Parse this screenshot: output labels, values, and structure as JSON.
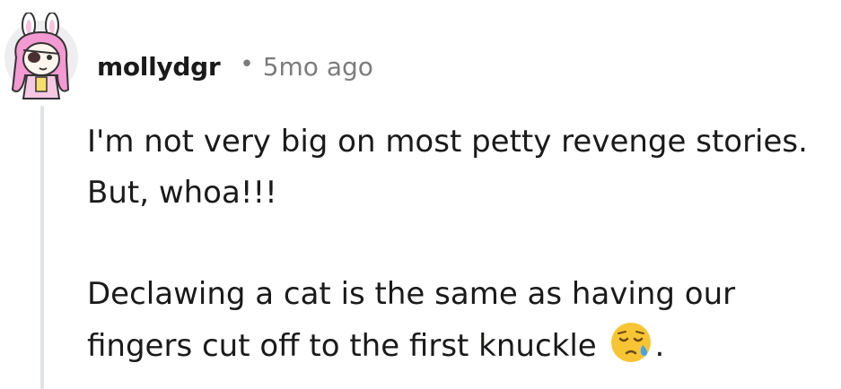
{
  "comment": {
    "author": "mollydgr",
    "separator": "•",
    "age": "5mo ago",
    "paragraphs": [
      "I'm not very big on most petty revenge stories. But, whoa!!!",
      "Declawing a cat is the same as having our fingers cut off to the first knuckle"
    ],
    "trailing_punct": ".",
    "emoji": "sad-but-relieved-face-icon"
  },
  "colors": {
    "text": "#1a1a1b",
    "meta": "#7c7c7c",
    "thread_line": "#e0e3e6",
    "avatar_hair": "#f39ad2",
    "emoji_face": "#f7c534"
  }
}
